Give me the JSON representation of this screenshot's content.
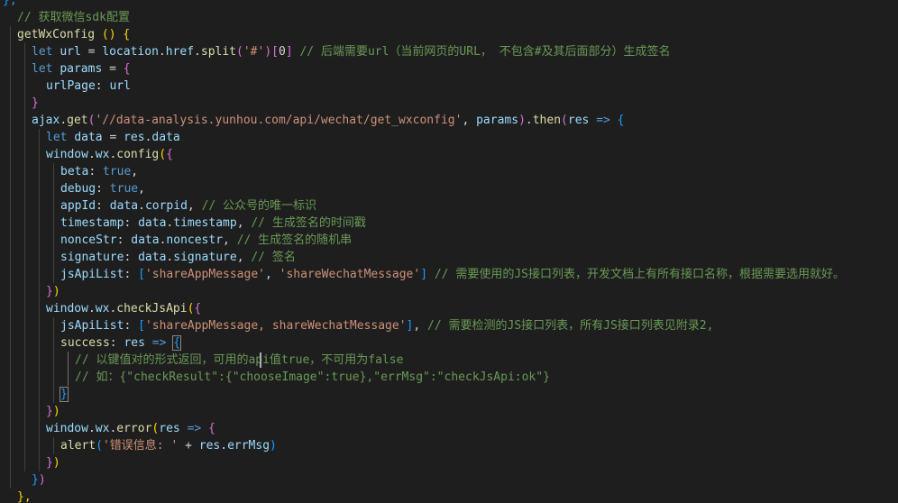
{
  "editor": {
    "language": "javascript",
    "theme": "dark",
    "colors": {
      "keyword": "#569cd6",
      "function": "#dcdcaa",
      "variable": "#9cdcfe",
      "string": "#ce9178",
      "comment": "#6a9955",
      "plain": "#d4d4d4",
      "bracket_level_1": "#ffd700",
      "bracket_level_2": "#da70d6",
      "bracket_level_3": "#179fff",
      "background": "#1e1e1e"
    },
    "lines": [
      [
        {
          "t": "},",
          "c": "b3"
        }
      ],
      [
        {
          "t": "// 获取微信sdk配置",
          "c": "cmt"
        }
      ],
      [
        {
          "t": "getWxConfig",
          "c": "fn"
        },
        {
          "t": " ",
          "c": "pl"
        },
        {
          "t": "()",
          "c": "b1"
        },
        {
          "t": " ",
          "c": "pl"
        },
        {
          "t": "{",
          "c": "b1"
        }
      ],
      [
        {
          "t": "let",
          "c": "kw"
        },
        {
          "t": " ",
          "c": "pl"
        },
        {
          "t": "url",
          "c": "var"
        },
        {
          "t": " = ",
          "c": "pl"
        },
        {
          "t": "location",
          "c": "var"
        },
        {
          "t": ".",
          "c": "pl"
        },
        {
          "t": "href",
          "c": "var"
        },
        {
          "t": ".",
          "c": "pl"
        },
        {
          "t": "split",
          "c": "fn"
        },
        {
          "t": "(",
          "c": "b2"
        },
        {
          "t": "'#'",
          "c": "str"
        },
        {
          "t": ")",
          "c": "b2"
        },
        {
          "t": "[",
          "c": "b2"
        },
        {
          "t": "0",
          "c": "pl"
        },
        {
          "t": "]",
          "c": "b2"
        },
        {
          "t": " // 后端需要url（当前网页的URL， 不包含#及其后面部分）生成签名",
          "c": "cmt"
        }
      ],
      [
        {
          "t": "let",
          "c": "kw"
        },
        {
          "t": " ",
          "c": "pl"
        },
        {
          "t": "params",
          "c": "var"
        },
        {
          "t": " = ",
          "c": "pl"
        },
        {
          "t": "{",
          "c": "b2"
        }
      ],
      [
        {
          "t": "urlPage",
          "c": "prop"
        },
        {
          "t": ": ",
          "c": "pl"
        },
        {
          "t": "url",
          "c": "var"
        }
      ],
      [
        {
          "t": "}",
          "c": "b2"
        }
      ],
      [
        {
          "t": "ajax",
          "c": "var"
        },
        {
          "t": ".",
          "c": "pl"
        },
        {
          "t": "get",
          "c": "fn"
        },
        {
          "t": "(",
          "c": "b2"
        },
        {
          "t": "'//data-analysis.yunhou.com/api/wechat/get_wxconfig'",
          "c": "str"
        },
        {
          "t": ", ",
          "c": "pl"
        },
        {
          "t": "params",
          "c": "var"
        },
        {
          "t": ")",
          "c": "b2"
        },
        {
          "t": ".",
          "c": "pl"
        },
        {
          "t": "then",
          "c": "fn"
        },
        {
          "t": "(",
          "c": "b2"
        },
        {
          "t": "res",
          "c": "var"
        },
        {
          "t": " ",
          "c": "pl"
        },
        {
          "t": "=>",
          "c": "kw"
        },
        {
          "t": " ",
          "c": "pl"
        },
        {
          "t": "{",
          "c": "b3"
        }
      ],
      [
        {
          "t": "let",
          "c": "kw"
        },
        {
          "t": " ",
          "c": "pl"
        },
        {
          "t": "data",
          "c": "var"
        },
        {
          "t": " = ",
          "c": "pl"
        },
        {
          "t": "res",
          "c": "var"
        },
        {
          "t": ".",
          "c": "pl"
        },
        {
          "t": "data",
          "c": "var"
        }
      ],
      [
        {
          "t": "window",
          "c": "var"
        },
        {
          "t": ".",
          "c": "pl"
        },
        {
          "t": "wx",
          "c": "var"
        },
        {
          "t": ".",
          "c": "pl"
        },
        {
          "t": "config",
          "c": "fn"
        },
        {
          "t": "(",
          "c": "b1"
        },
        {
          "t": "{",
          "c": "b2"
        }
      ],
      [
        {
          "t": "beta",
          "c": "prop"
        },
        {
          "t": ": ",
          "c": "pl"
        },
        {
          "t": "true",
          "c": "kw"
        },
        {
          "t": ",",
          "c": "pl"
        }
      ],
      [
        {
          "t": "debug",
          "c": "prop"
        },
        {
          "t": ": ",
          "c": "pl"
        },
        {
          "t": "true",
          "c": "kw"
        },
        {
          "t": ",",
          "c": "pl"
        }
      ],
      [
        {
          "t": "appId",
          "c": "prop"
        },
        {
          "t": ": ",
          "c": "pl"
        },
        {
          "t": "data",
          "c": "var"
        },
        {
          "t": ".",
          "c": "pl"
        },
        {
          "t": "corpid",
          "c": "var"
        },
        {
          "t": ", ",
          "c": "pl"
        },
        {
          "t": "// 公众号的唯一标识",
          "c": "cmt"
        }
      ],
      [
        {
          "t": "timestamp",
          "c": "prop"
        },
        {
          "t": ": ",
          "c": "pl"
        },
        {
          "t": "data",
          "c": "var"
        },
        {
          "t": ".",
          "c": "pl"
        },
        {
          "t": "timestamp",
          "c": "var"
        },
        {
          "t": ", ",
          "c": "pl"
        },
        {
          "t": "// 生成签名的时间戳",
          "c": "cmt"
        }
      ],
      [
        {
          "t": "nonceStr",
          "c": "prop"
        },
        {
          "t": ": ",
          "c": "pl"
        },
        {
          "t": "data",
          "c": "var"
        },
        {
          "t": ".",
          "c": "pl"
        },
        {
          "t": "noncestr",
          "c": "var"
        },
        {
          "t": ", ",
          "c": "pl"
        },
        {
          "t": "// 生成签名的随机串",
          "c": "cmt"
        }
      ],
      [
        {
          "t": "signature",
          "c": "prop"
        },
        {
          "t": ": ",
          "c": "pl"
        },
        {
          "t": "data",
          "c": "var"
        },
        {
          "t": ".",
          "c": "pl"
        },
        {
          "t": "signature",
          "c": "var"
        },
        {
          "t": ", ",
          "c": "pl"
        },
        {
          "t": "// 签名",
          "c": "cmt"
        }
      ],
      [
        {
          "t": "jsApiList",
          "c": "prop"
        },
        {
          "t": ": ",
          "c": "pl"
        },
        {
          "t": "[",
          "c": "b3"
        },
        {
          "t": "'shareAppMessage'",
          "c": "str"
        },
        {
          "t": ", ",
          "c": "pl"
        },
        {
          "t": "'shareWechatMessage'",
          "c": "str"
        },
        {
          "t": "]",
          "c": "b3"
        },
        {
          "t": " // 需要使用的JS接口列表，开发文档上有所有接口名称，根据需要选用就好。",
          "c": "cmt"
        }
      ],
      [
        {
          "t": "}",
          "c": "b2"
        },
        {
          "t": ")",
          "c": "b1"
        }
      ],
      [
        {
          "t": "window",
          "c": "var"
        },
        {
          "t": ".",
          "c": "pl"
        },
        {
          "t": "wx",
          "c": "var"
        },
        {
          "t": ".",
          "c": "pl"
        },
        {
          "t": "checkJsApi",
          "c": "fn"
        },
        {
          "t": "(",
          "c": "b1"
        },
        {
          "t": "{",
          "c": "b2"
        }
      ],
      [
        {
          "t": "jsApiList",
          "c": "prop"
        },
        {
          "t": ": ",
          "c": "pl"
        },
        {
          "t": "[",
          "c": "b3"
        },
        {
          "t": "'shareAppMessage, shareWechatMessage'",
          "c": "str"
        },
        {
          "t": "]",
          "c": "b3"
        },
        {
          "t": ", ",
          "c": "pl"
        },
        {
          "t": "// 需要检测的JS接口列表，所有JS接口列表见附录2,",
          "c": "cmt"
        }
      ],
      [
        {
          "t": "success",
          "c": "fn"
        },
        {
          "t": ": ",
          "c": "pl"
        },
        {
          "t": "res",
          "c": "var"
        },
        {
          "t": " ",
          "c": "pl"
        },
        {
          "t": "=>",
          "c": "kw"
        },
        {
          "t": " ",
          "c": "pl"
        },
        {
          "t": "{",
          "c": "b3",
          "m": true
        }
      ],
      [
        {
          "t": "// 以键值对的形式返回，可用的api值true，不可用为false",
          "c": "cmt"
        }
      ],
      [
        {
          "t": "// 如：{\"checkResult\":{\"chooseImage\":true},\"errMsg\":\"checkJsApi:ok\"}",
          "c": "cmt"
        }
      ],
      [
        {
          "t": "}",
          "c": "b3",
          "m": true
        }
      ],
      [
        {
          "t": "}",
          "c": "b2"
        },
        {
          "t": ")",
          "c": "b1"
        }
      ],
      [
        {
          "t": "window",
          "c": "var"
        },
        {
          "t": ".",
          "c": "pl"
        },
        {
          "t": "wx",
          "c": "var"
        },
        {
          "t": ".",
          "c": "pl"
        },
        {
          "t": "error",
          "c": "fn"
        },
        {
          "t": "(",
          "c": "b1"
        },
        {
          "t": "res",
          "c": "var"
        },
        {
          "t": " ",
          "c": "pl"
        },
        {
          "t": "=>",
          "c": "kw"
        },
        {
          "t": " ",
          "c": "pl"
        },
        {
          "t": "{",
          "c": "b2"
        }
      ],
      [
        {
          "t": "alert",
          "c": "fn"
        },
        {
          "t": "(",
          "c": "b3"
        },
        {
          "t": "'错误信息: '",
          "c": "str"
        },
        {
          "t": " + ",
          "c": "pl"
        },
        {
          "t": "res",
          "c": "var"
        },
        {
          "t": ".",
          "c": "pl"
        },
        {
          "t": "errMsg",
          "c": "var"
        },
        {
          "t": ")",
          "c": "b3"
        }
      ],
      [
        {
          "t": "}",
          "c": "b2"
        },
        {
          "t": ")",
          "c": "b1"
        }
      ],
      [
        {
          "t": "}",
          "c": "b3"
        },
        {
          "t": ")",
          "c": "b2"
        }
      ],
      [
        {
          "t": "},",
          "c": "b1"
        }
      ]
    ]
  }
}
